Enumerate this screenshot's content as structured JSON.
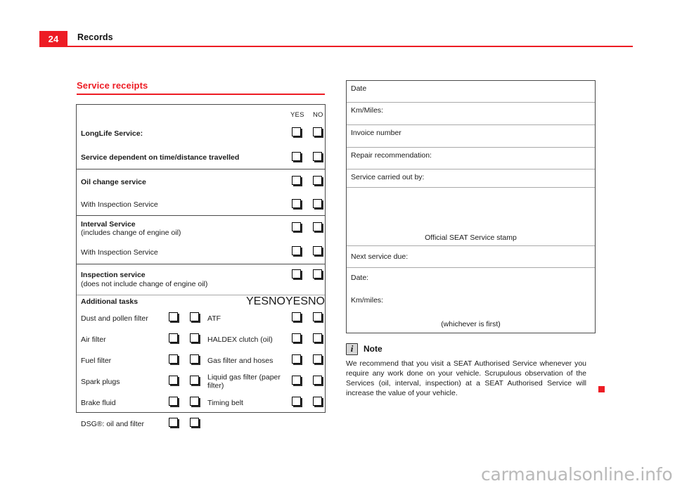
{
  "header": {
    "page_number": "24",
    "title": "Records",
    "rule_color": "#ed1c24"
  },
  "section": {
    "heading": "Service receipts",
    "heading_color": "#ed1c24"
  },
  "checklist": {
    "yes_label": "YES",
    "no_label": "NO",
    "service_rows": [
      {
        "label": "LongLife Service:",
        "bold": true,
        "sub": ""
      },
      {
        "label": "Service dependent on time/distance travelled",
        "bold": true,
        "sub": ""
      },
      {
        "label": "Oil change service",
        "bold": true,
        "sub": ""
      },
      {
        "label": "With Inspection Service",
        "bold": false,
        "sub": ""
      },
      {
        "label": "Interval Service",
        "bold": true,
        "sub": "(includes change of engine oil)"
      },
      {
        "label": "With Inspection Service",
        "bold": false,
        "sub": ""
      },
      {
        "label": "Inspection service",
        "bold": true,
        "sub": "(does not include change of engine oil)"
      }
    ],
    "additional_header": "Additional tasks",
    "additional_rows": [
      {
        "left": "Dust and pollen filter",
        "right": "ATF"
      },
      {
        "left": "Air filter",
        "right": "HALDEX clutch (oil)"
      },
      {
        "left": "Fuel filter",
        "right": "Gas filter and hoses"
      },
      {
        "left": "Spark plugs",
        "right": "Liquid gas filter (paper filter)"
      },
      {
        "left": "Brake fluid",
        "right": "Timing belt"
      },
      {
        "left": "DSG®: oil and filter",
        "right": ""
      }
    ]
  },
  "record": {
    "rows": [
      {
        "label": "Date"
      },
      {
        "label": "Km/Miles:"
      },
      {
        "label": "Invoice number"
      },
      {
        "label": "Repair recommendation:"
      },
      {
        "label": "Service carried out by:"
      }
    ],
    "stamp_label": "Official SEAT Service stamp",
    "next_service_label": "Next service due:",
    "date_label": "Date:",
    "km_label": "Km/miles:",
    "whichever_label": "(whichever is first)"
  },
  "note": {
    "icon": "info-icon",
    "title": "Note",
    "body": "We recommend that you visit a SEAT Authorised Service whenever you require any work done on your vehicle. Scrupulous observation of the Services (oil, interval, inspection) at a SEAT Authorised Service will increase the value of your vehicle."
  },
  "watermark": {
    "text": "carmanualsonline.info"
  }
}
